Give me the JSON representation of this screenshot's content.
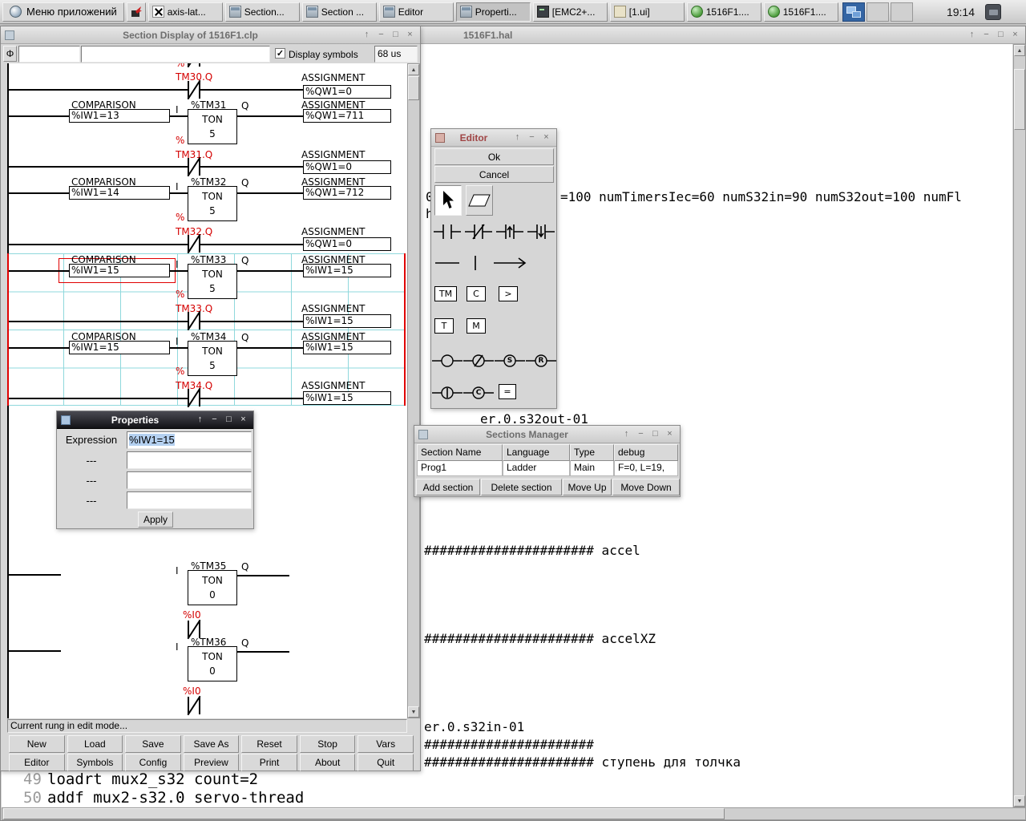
{
  "colors": {
    "wire": "#000000",
    "ladder_red": "#d40000",
    "grid_cyan": "#8fd8dc",
    "selection_blue": "#b4d0f0",
    "active_titlebar": "#121216",
    "pager_blue": "#3465a4"
  },
  "icons": {
    "shade": "↑",
    "minimize": "−",
    "maximize": "□",
    "close": "×",
    "check": "✓",
    "phi": "Φ",
    "scroll_up": "▲",
    "scroll_down": "▼"
  },
  "taskbar": {
    "menu_label": "Меню приложений",
    "clock": "19:14",
    "buttons": [
      {
        "label": "axis-lat...",
        "icon": "x11-icon",
        "active": false
      },
      {
        "label": "Section...",
        "icon": "window-icon",
        "active": false
      },
      {
        "label": "Section ...",
        "icon": "window-icon",
        "active": false
      },
      {
        "label": "Editor",
        "icon": "window-icon",
        "active": false
      },
      {
        "label": "Properti...",
        "icon": "window-icon",
        "active": true
      },
      {
        "label": "[EMC2+...",
        "icon": "terminal-icon",
        "active": false
      },
      {
        "label": "[1.ui]",
        "icon": "ui-icon",
        "active": false
      },
      {
        "label": "1516F1....",
        "icon": "hal-icon",
        "active": false
      },
      {
        "label": "1516F1....",
        "icon": "hal-icon",
        "active": false
      }
    ]
  },
  "section_display": {
    "title": "Section Display of 1516F1.clp",
    "toolbar": {
      "field_small": "",
      "field_large": "",
      "display_symbols_label": "Display symbols",
      "scan_time": "68 us"
    },
    "status": "Current rung in edit mode...",
    "buttons_row1": [
      "New",
      "Load",
      "Save",
      "Save As",
      "Reset",
      "Stop",
      "Vars"
    ],
    "buttons_row2": [
      "Editor",
      "Symbols",
      "Config",
      "Preview",
      "Print",
      "About",
      "Quit"
    ],
    "ladder": {
      "rungs": [
        {
          "kind": "contact",
          "prefix": "%",
          "name": "TM30.Q",
          "assign_caption": "ASSIGNMENT",
          "assign": "%QW1=0"
        },
        {
          "kind": "comparison_timer",
          "cmp_caption": "COMPARISON",
          "cmp": "%IW1=13",
          "input_pin": "I",
          "timer_name": "%TM31",
          "timer_type": "TON",
          "timer_preset": "5",
          "output_pin": "Q",
          "assign_caption": "ASSIGNMENT",
          "assign": "%QW1=711"
        },
        {
          "kind": "contact",
          "prefix": "%",
          "name": "TM31.Q",
          "assign_caption": "ASSIGNMENT",
          "assign": "%QW1=0"
        },
        {
          "kind": "comparison_timer",
          "cmp_caption": "COMPARISON",
          "cmp": "%IW1=14",
          "input_pin": "I",
          "timer_name": "%TM32",
          "timer_type": "TON",
          "timer_preset": "5",
          "output_pin": "Q",
          "assign_caption": "ASSIGNMENT",
          "assign": "%QW1=712"
        },
        {
          "kind": "contact",
          "prefix": "%",
          "name": "TM32.Q",
          "assign_caption": "ASSIGNMENT",
          "assign": "%QW1=0"
        },
        {
          "kind": "comparison_timer",
          "selected": true,
          "cmp_caption": "COMPARISON",
          "cmp": "%IW1=15",
          "input_pin": "I",
          "timer_name": "%TM33",
          "timer_type": "TON",
          "timer_preset": "5",
          "output_pin": "Q",
          "assign_caption": "ASSIGNMENT",
          "assign": "%IW1=15"
        },
        {
          "kind": "contact",
          "prefix": "%",
          "name": "TM33.Q",
          "assign_caption": "ASSIGNMENT",
          "assign": "%IW1=15"
        },
        {
          "kind": "comparison_timer",
          "cmp_caption": "COMPARISON",
          "cmp": "%IW1=15",
          "input_pin": "I",
          "timer_name": "%TM34",
          "timer_type": "TON",
          "timer_preset": "5",
          "output_pin": "Q",
          "assign_caption": "ASSIGNMENT",
          "assign": "%IW1=15"
        },
        {
          "kind": "contact",
          "prefix": "%",
          "name": "TM34.Q",
          "assign_caption": "ASSIGNMENT",
          "assign": "%IW1=15"
        },
        {
          "kind": "timer",
          "input_pin": "I",
          "timer_name": "%TM35",
          "timer_type": "TON",
          "timer_preset": "0",
          "output_pin": "Q",
          "contact_name": "%I0"
        },
        {
          "kind": "timer",
          "input_pin": "I",
          "timer_name": "%TM36",
          "timer_type": "TON",
          "timer_preset": "0",
          "output_pin": "Q",
          "contact_name": "%I0"
        }
      ]
    }
  },
  "hal_window": {
    "title": "1516F1.hal",
    "fragments": [
      "0",
      "=100 numTimersIec=60 numS32in=90 numS32out=100 numFl",
      "h",
      "er.0.s32out-01",
      "###################### accel",
      "###################### accelXZ",
      "er.0.s32in-01",
      "######################",
      "###################### ступень для толчка"
    ],
    "lines": [
      {
        "num": "49",
        "text": "loadrt mux2_s32 count=2"
      },
      {
        "num": "50",
        "text": "addf mux2-s32.0 servo-thread"
      }
    ]
  },
  "editor_window": {
    "title": "Editor",
    "ok_label": "Ok",
    "cancel_label": "Cancel",
    "block_labels": [
      "TM",
      "C",
      ">",
      "T",
      "M"
    ],
    "coil_letters": {
      "set": "S",
      "reset": "R",
      "jump": "|",
      "call": "C",
      "operate": "="
    }
  },
  "sections_manager": {
    "title": "Sections Manager",
    "headers": [
      "Section Name",
      "Language",
      "Type",
      "debug"
    ],
    "row": [
      "Prog1",
      "Ladder",
      "Main",
      "F=0, L=19,"
    ],
    "buttons": [
      "Add section",
      "Delete section",
      "Move Up",
      "Move Down"
    ]
  },
  "properties": {
    "title": "Properties",
    "rows": [
      {
        "label": "Expression",
        "value": "%IW1=15"
      },
      {
        "label": "---",
        "value": ""
      },
      {
        "label": "---",
        "value": ""
      },
      {
        "label": "---",
        "value": ""
      }
    ],
    "apply_label": "Apply"
  }
}
